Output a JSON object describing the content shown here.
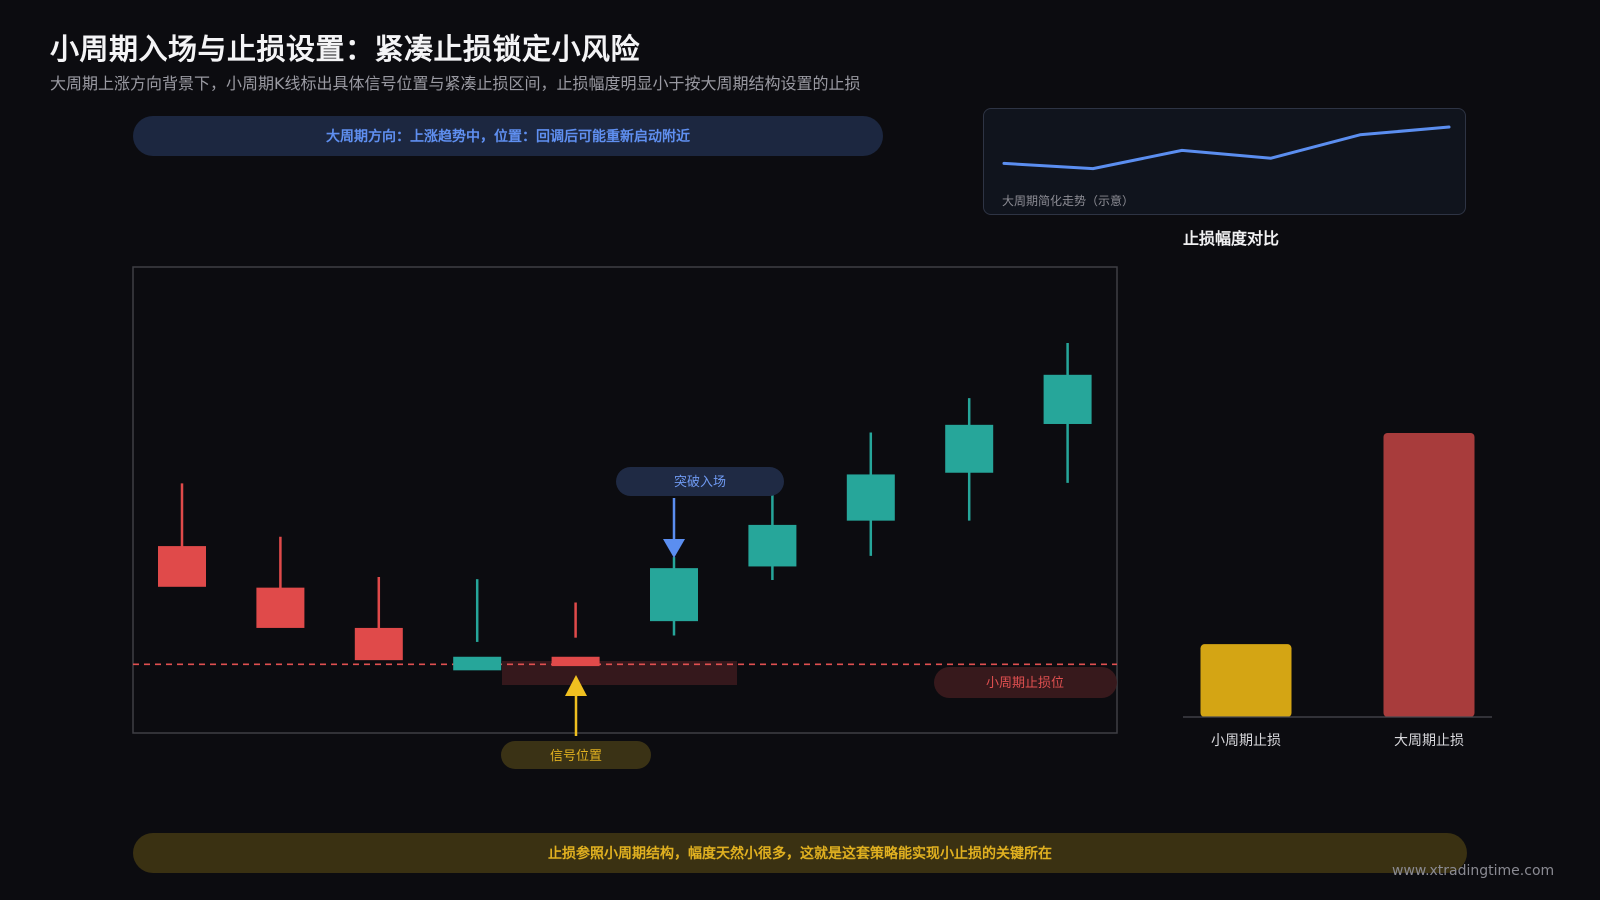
{
  "header": {
    "title": "小周期入场与止损设置：紧凑止损锁定小风险",
    "subtitle": "大周期上涨方向背景下，小周期K线标出具体信号位置与紧凑止损区间，止损幅度明显小于按大周期结构设置的止损"
  },
  "direction_banner": "大周期方向：上涨趋势中，位置：回调后可能重新启动附近",
  "mini_trend": {
    "caption": "大周期简化走势（示意）",
    "values": [
      0.3,
      0.2,
      0.55,
      0.4,
      0.85,
      1.0
    ],
    "color": "#5b8ef0"
  },
  "comparison_title": "止损幅度对比",
  "annotations": {
    "entry_label": "突破入场",
    "signal_label": "信号位置",
    "stop_label": "小周期止损位"
  },
  "bottom_banner": "止损参照小周期结构，幅度天然小很多，这就是这套策略能实现小止损的关键所在",
  "watermark": "www.xtradingtime.com",
  "colors": {
    "bullish": "#26a69a",
    "bearish": "#e04a4a",
    "entry_arrow": "#5b8ef0",
    "signal_arrow": "#f0c020",
    "stop_line": "#e05050",
    "small_stop_bar": "#d4a514",
    "large_stop_bar": "#a83c3c"
  },
  "chart_data": [
    {
      "type": "candlestick",
      "title": "",
      "ylim": [
        0,
        100
      ],
      "candles": [
        {
          "open": 39.6,
          "close": 30.0,
          "high": 54.4,
          "low": 33.0
        },
        {
          "open": 29.8,
          "close": 20.3,
          "high": 41.8,
          "low": 21.0
        },
        {
          "open": 20.3,
          "close": 12.7,
          "high": 32.3,
          "low": 13.0
        },
        {
          "open": 10.3,
          "close": 13.5,
          "high": 31.8,
          "low": 17.0
        },
        {
          "open": 13.5,
          "close": 11.3,
          "high": 26.3,
          "low": 18.0
        },
        {
          "open": 21.9,
          "close": 34.4,
          "high": 37.0,
          "low": 18.5
        },
        {
          "open": 34.8,
          "close": 44.6,
          "high": 55.7,
          "low": 31.6
        },
        {
          "open": 45.6,
          "close": 56.5,
          "high": 66.4,
          "low": 37.3
        },
        {
          "open": 56.9,
          "close": 68.2,
          "high": 74.5,
          "low": 45.6
        },
        {
          "open": 68.4,
          "close": 80.0,
          "high": 87.5,
          "low": 54.5
        }
      ],
      "stop_level": 10.3,
      "entry_candle": 6,
      "signal_candle": 5
    },
    {
      "type": "bar",
      "title": "止损幅度对比",
      "categories": [
        "小周期止损",
        "大周期止损"
      ],
      "values": [
        1,
        3.9
      ]
    }
  ]
}
